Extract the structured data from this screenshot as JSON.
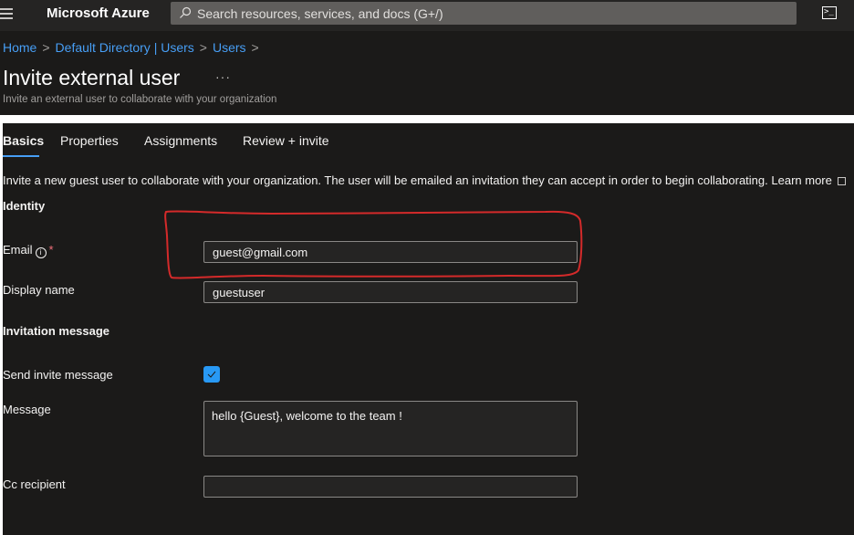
{
  "topbar": {
    "brand": "Microsoft Azure",
    "search_placeholder": "Search resources, services, and docs (G+/)",
    "icons": {
      "menu": "hamburger-icon",
      "search": "search-icon",
      "shell": "cloud-shell-icon"
    }
  },
  "breadcrumb": [
    {
      "label": "Home"
    },
    {
      "label": "Default Directory | Users"
    },
    {
      "label": "Users"
    }
  ],
  "breadcrumb_sep": ">",
  "header": {
    "title": "Invite external user",
    "more": "···",
    "subtitle": "Invite an external user to collaborate with your organization"
  },
  "tabs": [
    {
      "label": "Basics",
      "active": true
    },
    {
      "label": "Properties",
      "active": false
    },
    {
      "label": "Assignments",
      "active": false
    },
    {
      "label": "Review + invite",
      "active": false
    }
  ],
  "intro": {
    "text": "Invite a new guest user to collaborate with your organization. The user will be emailed an invitation they can accept in order to begin collaborating.",
    "learn_more": "Learn more"
  },
  "identity": {
    "heading": "Identity",
    "email_label": "Email",
    "required_mark": "*",
    "email_value": "guest@gmail.com",
    "display_name_label": "Display name",
    "display_name_value": "guestuser"
  },
  "invitation": {
    "heading": "Invitation message",
    "send_label": "Send invite message",
    "send_checked": true,
    "message_label": "Message",
    "message_value": "hello {Guest}, welcome to the team !",
    "cc_label": "Cc recipient",
    "cc_value": ""
  },
  "colors": {
    "accent": "#479ef5",
    "checkbox": "#2899f5",
    "annotation": "#d42a2a",
    "required": "#f1707b"
  }
}
